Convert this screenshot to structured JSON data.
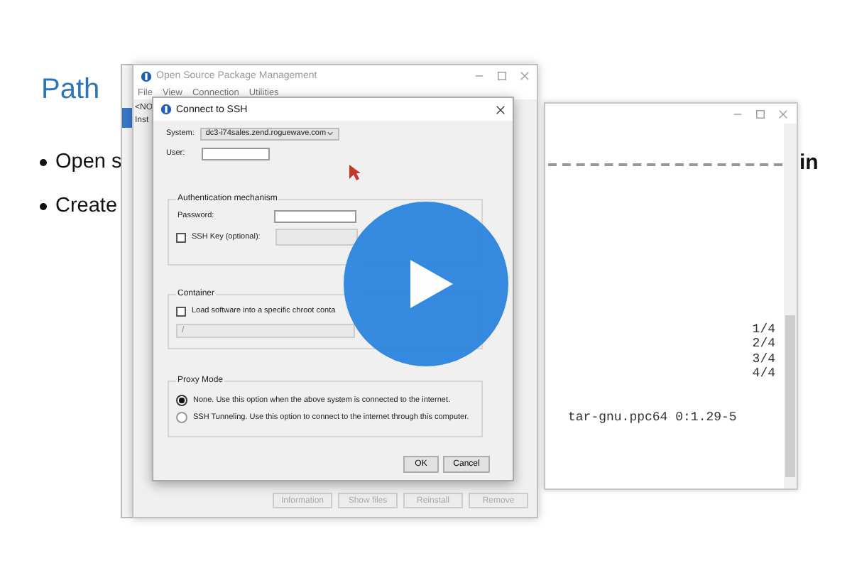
{
  "slide": {
    "title": "Path",
    "bullets": [
      "Open s",
      "Create"
    ],
    "fragment": "in"
  },
  "terminal": {
    "lines": [
      "1/4",
      "2/4",
      "3/4",
      "4/4"
    ],
    "package": "tar-gnu.ppc64 0:1.29-5"
  },
  "main_window": {
    "title": "Open Source Package Management",
    "menu": [
      "File",
      "View",
      "Connection",
      "Utilities"
    ],
    "list_fragments": [
      "<NO",
      "Inst"
    ],
    "buttons": [
      {
        "label": "Information",
        "disabled": true
      },
      {
        "label": "Show files",
        "disabled": true
      },
      {
        "label": "Reinstall",
        "disabled": true
      },
      {
        "label": "Remove",
        "disabled": true
      }
    ]
  },
  "dialog": {
    "title": "Connect to SSH",
    "system": {
      "label": "System:",
      "value": "dc3-i74sales.zend.roguewave.com"
    },
    "user": {
      "label": "User:"
    },
    "auth": {
      "title": "Authentication mechanism",
      "password": {
        "label": "Password:"
      },
      "ssh_key": {
        "label": "SSH Key (optional):",
        "checked": false
      }
    },
    "container": {
      "title": "Container",
      "checkbox": {
        "label": "Load software into a specific chroot conta",
        "checked": false
      },
      "path": "/"
    },
    "proxy": {
      "title": "Proxy Mode",
      "options": [
        {
          "label": "None. Use this option when the above system is connected to the internet.",
          "selected": true
        },
        {
          "label": "SSH Tunneling. Use this option to connect to the internet through this computer.",
          "selected": false
        }
      ]
    },
    "buttons": [
      "OK",
      "Cancel"
    ]
  }
}
